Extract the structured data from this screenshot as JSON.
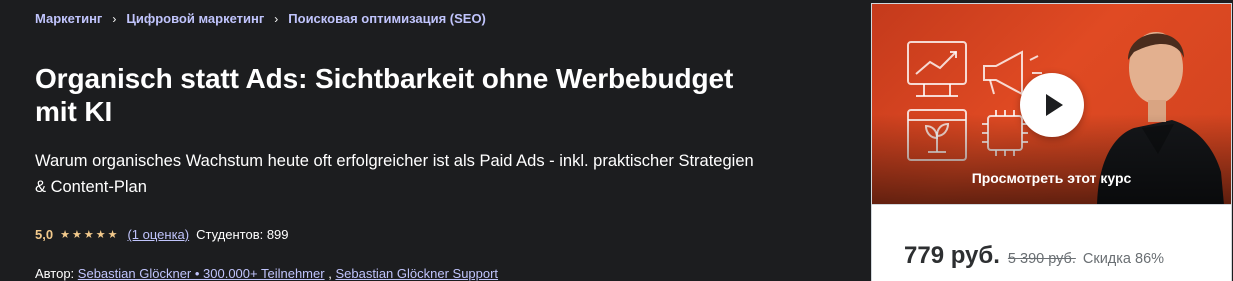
{
  "breadcrumb": {
    "items": [
      "Маркетинг",
      "Цифровой маркетинг",
      "Поисковая оптимизация (SEO)"
    ],
    "separator": "›"
  },
  "course": {
    "title": "Organisch statt Ads: Sichtbarkeit ohne Werbebudget mit KI",
    "subtitle": "Warum organisches Wachstum heute oft erfolgreicher ist als Paid Ads - inkl. praktischer Strategien & Content-Plan"
  },
  "rating": {
    "value": "5,0",
    "stars": 5,
    "count_label": "(1 оценка)",
    "students_label": "Студентов: 899"
  },
  "author": {
    "prefix": "Автор:",
    "names": [
      "Sebastian Glöckner • 300.000+ Teilnehmer",
      "Sebastian Glöckner Support"
    ],
    "separator": ","
  },
  "preview": {
    "label": "Просмотреть этот курс",
    "icons": [
      "growth-chart-icon",
      "megaphone-icon",
      "plant-icon",
      "ai-chip-icon"
    ],
    "accent_color": "#d9441f"
  },
  "pricing": {
    "current": "779 руб.",
    "original": "5 390 руб.",
    "discount": "Скидка 86%"
  }
}
